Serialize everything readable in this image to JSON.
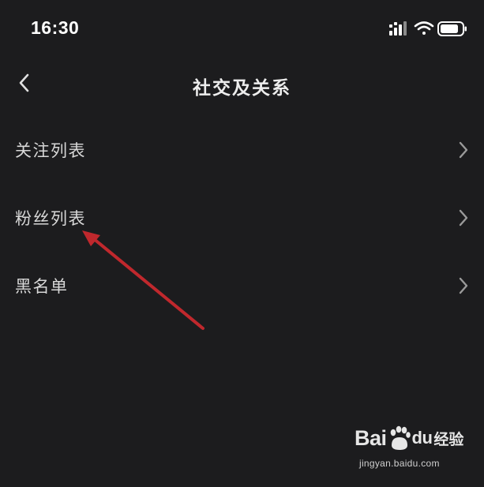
{
  "status_bar": {
    "time": "16:30",
    "icons": [
      "cellular-signal-icon",
      "wifi-icon",
      "battery-icon"
    ]
  },
  "nav": {
    "title": "社交及关系",
    "back_icon": "chevron-left-icon"
  },
  "menu": {
    "items": [
      {
        "label": "关注列表",
        "icon": "chevron-right-icon"
      },
      {
        "label": "粉丝列表",
        "icon": "chevron-right-icon"
      },
      {
        "label": "黑名单",
        "icon": "chevron-right-icon"
      }
    ]
  },
  "annotation": {
    "type": "arrow",
    "color": "#c0282d",
    "points_to": "粉丝列表"
  },
  "watermark": {
    "logo_text_bai": "Bai",
    "logo_text_du": "du",
    "logo_text_jingyan": "经验",
    "url": "jingyan.baidu.com"
  },
  "colors": {
    "background": "#1c1c1e",
    "text": "#d8d8d8",
    "title": "#ededed",
    "chevron": "#9a9a9a"
  }
}
